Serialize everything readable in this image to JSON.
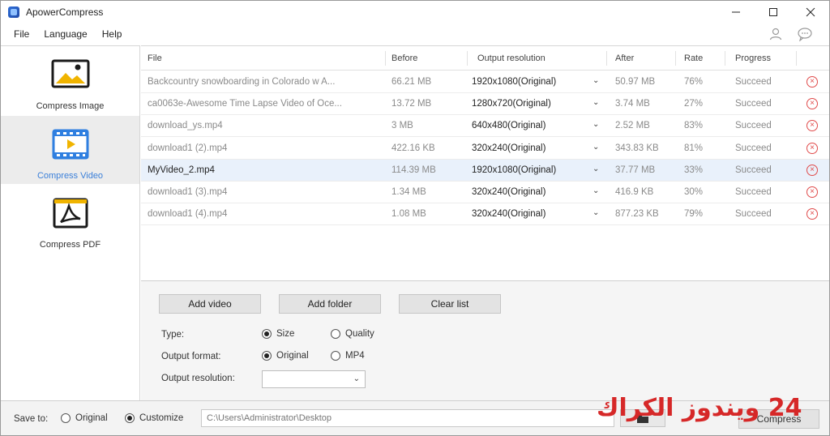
{
  "window": {
    "title": "ApowerCompress",
    "controls": [
      "minimize",
      "maximize",
      "close"
    ]
  },
  "menu": {
    "items": [
      "File",
      "Language",
      "Help"
    ]
  },
  "sidebar": {
    "items": [
      {
        "label": "Compress Image",
        "icon": "image-icon",
        "active": false
      },
      {
        "label": "Compress Video",
        "icon": "video-icon",
        "active": true
      },
      {
        "label": "Compress PDF",
        "icon": "pdf-icon",
        "active": false
      }
    ]
  },
  "table": {
    "headers": {
      "file": "File",
      "before": "Before",
      "resolution": "Output resolution",
      "after": "After",
      "rate": "Rate",
      "progress": "Progress"
    },
    "rows": [
      {
        "file": "Backcountry snowboarding in Colorado w A...",
        "before": "66.21 MB",
        "resolution": "1920x1080(Original)",
        "after": "50.97 MB",
        "rate": "76%",
        "progress": "Succeed",
        "highlight": false
      },
      {
        "file": "ca0063e-Awesome Time Lapse Video of Oce...",
        "before": "13.72 MB",
        "resolution": "1280x720(Original)",
        "after": "3.74 MB",
        "rate": "27%",
        "progress": "Succeed",
        "highlight": false
      },
      {
        "file": "download_ys.mp4",
        "before": "3 MB",
        "resolution": "640x480(Original)",
        "after": "2.52 MB",
        "rate": "83%",
        "progress": "Succeed",
        "highlight": false
      },
      {
        "file": "download1 (2).mp4",
        "before": "422.16 KB",
        "resolution": "320x240(Original)",
        "after": "343.83 KB",
        "rate": "81%",
        "progress": "Succeed",
        "highlight": false
      },
      {
        "file": "MyVideo_2.mp4",
        "before": "114.39 MB",
        "resolution": "1920x1080(Original)",
        "after": "37.77 MB",
        "rate": "33%",
        "progress": "Succeed",
        "highlight": true
      },
      {
        "file": "download1 (3).mp4",
        "before": "1.34 MB",
        "resolution": "320x240(Original)",
        "after": "416.9 KB",
        "rate": "30%",
        "progress": "Succeed",
        "highlight": false
      },
      {
        "file": "download1 (4).mp4",
        "before": "1.08 MB",
        "resolution": "320x240(Original)",
        "after": "877.23 KB",
        "rate": "79%",
        "progress": "Succeed",
        "highlight": false
      }
    ]
  },
  "options": {
    "buttons": {
      "add_video": "Add video",
      "add_folder": "Add folder",
      "clear_list": "Clear list"
    },
    "type_label": "Type:",
    "type_size": "Size",
    "type_quality": "Quality",
    "format_label": "Output format:",
    "format_original": "Original",
    "format_mp4": "MP4",
    "resolution_label": "Output resolution:",
    "resolution_value": ""
  },
  "bottom": {
    "save_to_label": "Save to:",
    "save_original": "Original",
    "save_customize": "Customize",
    "path": "C:\\Users\\Administrator\\Desktop",
    "compress_label": "Compress"
  },
  "watermark": "24 ويندوز الكراك",
  "colors": {
    "accent": "#3a7fd9",
    "delete": "#e04b4b",
    "highlight_row": "#e9f1fb",
    "watermark": "#d62828"
  }
}
